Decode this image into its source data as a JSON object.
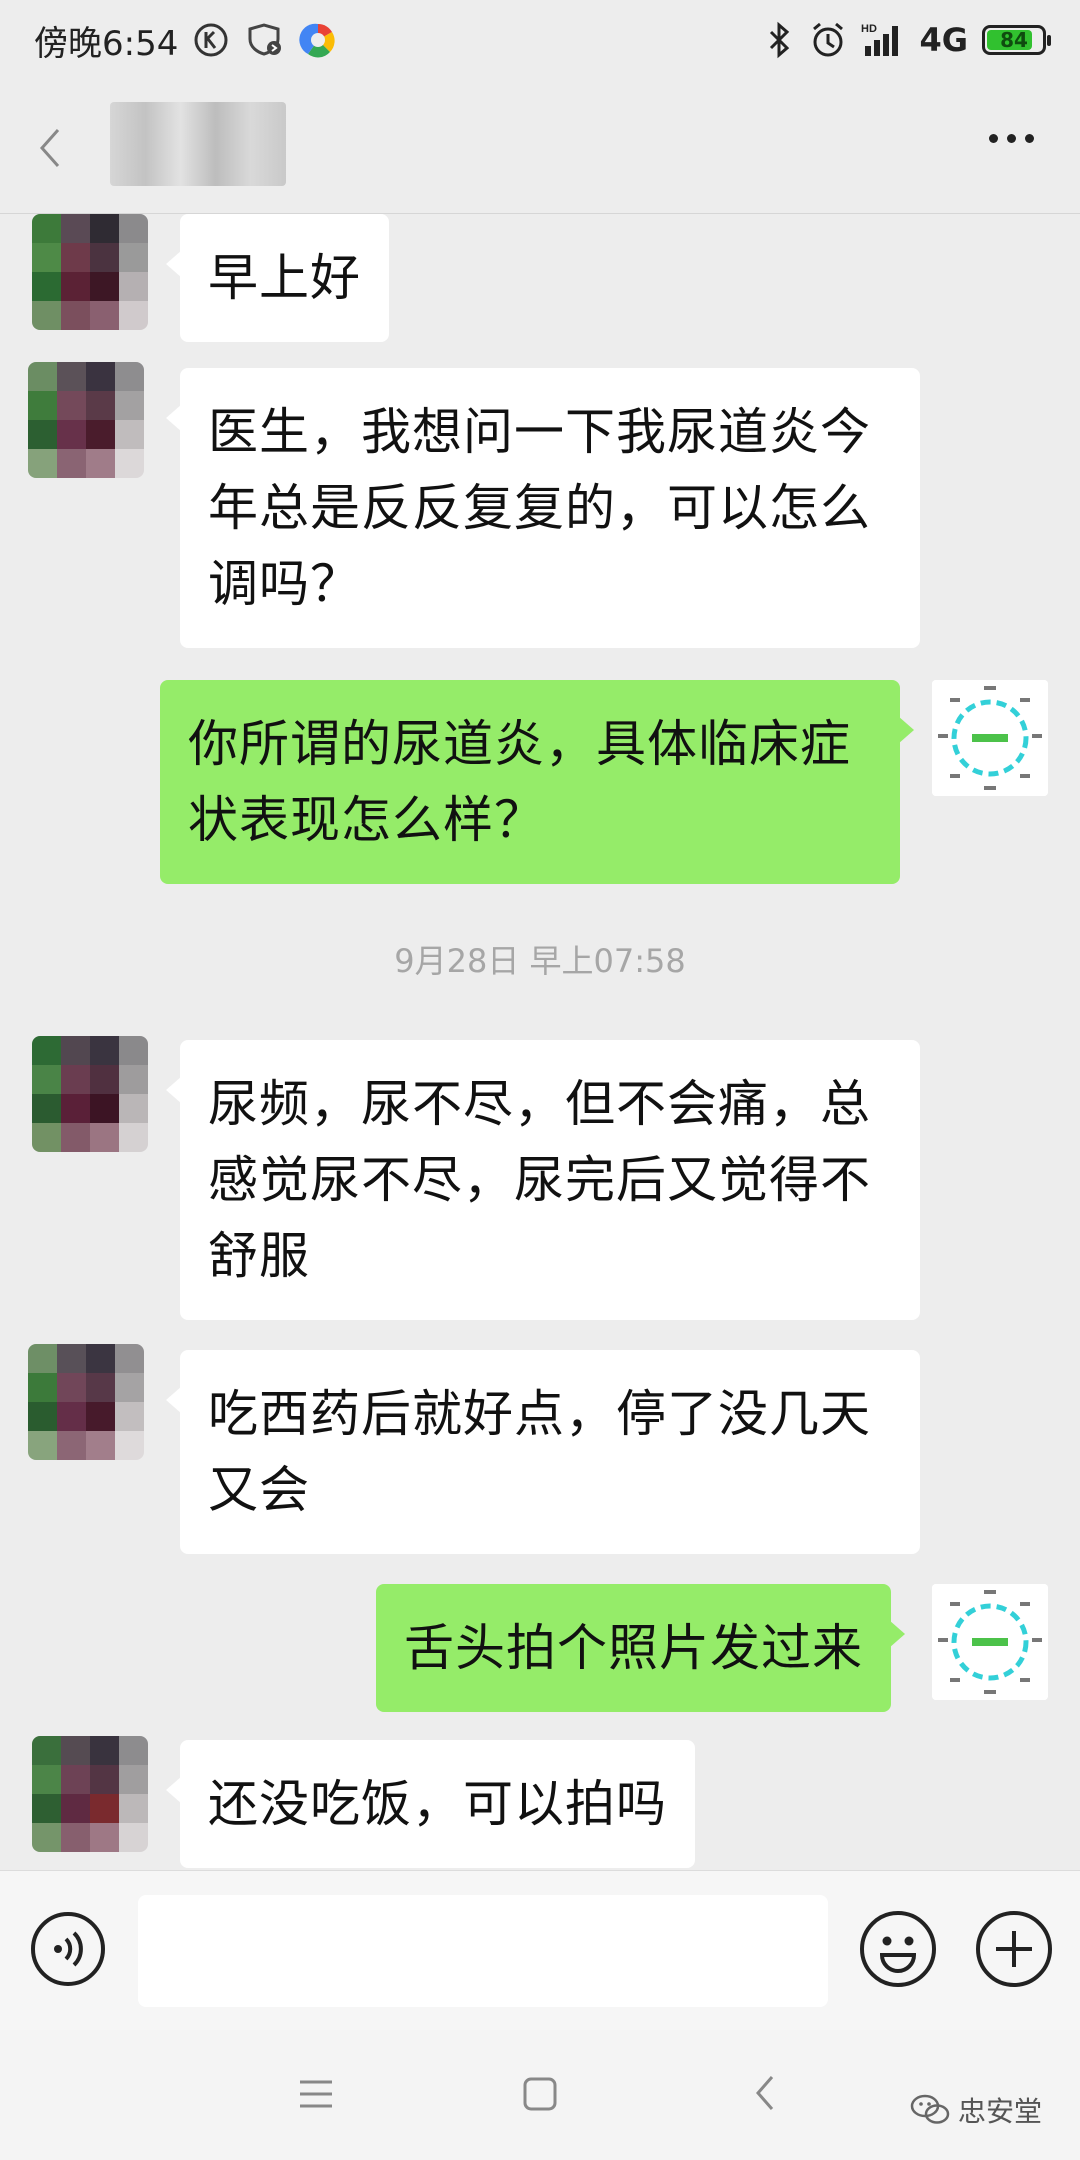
{
  "status_bar": {
    "time": "傍晚6:54",
    "network": "4G",
    "battery": "84",
    "battery_level": 0.84
  },
  "header": {
    "contact_name": "████",
    "more_label": "more"
  },
  "chat": {
    "messages": [
      {
        "sender": "contact",
        "text": "早上好"
      },
      {
        "sender": "contact",
        "text": "医生，我想问一下我尿道炎今年总是反反复复的，可以怎么调吗？"
      },
      {
        "sender": "self",
        "text": "你所谓的尿道炎，具体临床症状表现怎么样？"
      },
      {
        "sender": "contact",
        "text": "尿频，尿不尽，但不会痛，总感觉尿不尽，尿完后又觉得不舒服"
      },
      {
        "sender": "contact",
        "text": "吃西药后就好点，停了没几天又会"
      },
      {
        "sender": "self",
        "text": "舌头拍个照片发过来"
      },
      {
        "sender": "contact",
        "text": "还没吃饭，可以拍吗"
      }
    ],
    "timestamp": "9月28日 早上07:58"
  },
  "input_bar": {
    "placeholder": ""
  },
  "watermark": "忠安堂",
  "colors": {
    "self_bubble": "#95ec69",
    "contact_bubble": "#ffffff",
    "background": "#ededed",
    "battery_green": "#31c12f"
  }
}
